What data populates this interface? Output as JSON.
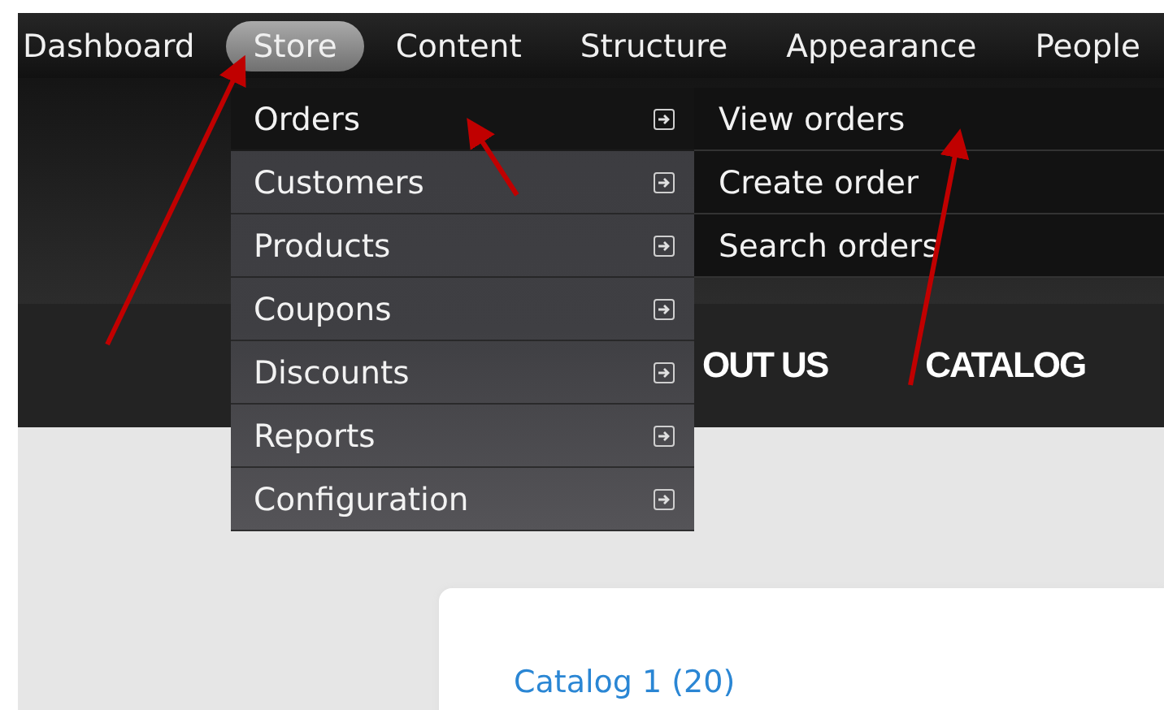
{
  "toolbar": {
    "items": [
      {
        "label": "Dashboard",
        "selected": false
      },
      {
        "label": "Store",
        "selected": true
      },
      {
        "label": "Content",
        "selected": false
      },
      {
        "label": "Structure",
        "selected": false
      },
      {
        "label": "Appearance",
        "selected": false
      },
      {
        "label": "People",
        "selected": false
      }
    ]
  },
  "menu": {
    "items": [
      {
        "label": "Orders",
        "selected": true
      },
      {
        "label": "Customers",
        "selected": false
      },
      {
        "label": "Products",
        "selected": false
      },
      {
        "label": "Coupons",
        "selected": false
      },
      {
        "label": "Discounts",
        "selected": false
      },
      {
        "label": "Reports",
        "selected": false
      },
      {
        "label": "Configuration",
        "selected": false
      }
    ]
  },
  "submenu": {
    "items": [
      {
        "label": "View orders"
      },
      {
        "label": "Create order"
      },
      {
        "label": "Search orders"
      }
    ]
  },
  "site": {
    "nav": [
      {
        "label": "OUT US"
      },
      {
        "label": "CATALOG"
      }
    ],
    "card": {
      "link": "Catalog 1 (20)"
    }
  }
}
